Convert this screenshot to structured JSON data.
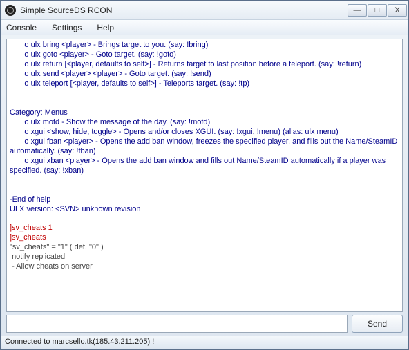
{
  "window": {
    "title": "Simple SourceDS RCON",
    "buttons": {
      "min": "—",
      "max": "□",
      "close": "X"
    }
  },
  "menu": {
    "console": "Console",
    "settings": "Settings",
    "help": "Help"
  },
  "console": {
    "blue1": "       o ulx bring <player> - Brings target to you. (say: !bring)\n       o ulx goto <player> - Goto target. (say: !goto)\n       o ulx return [<player, defaults to self>] - Returns target to last position before a teleport. (say: !return)\n       o ulx send <player> <player> - Goto target. (say: !send)\n       o ulx teleport [<player, defaults to self>] - Teleports target. (say: !tp)\n\n\nCategory: Menus\n       o ulx motd - Show the message of the day. (say: !motd)\n       o xgui <show, hide, toggle> - Opens and/or closes XGUI. (say: !xgui, !menu) (alias: ulx menu)\n       o xgui fban <player> - Opens the add ban window, freezes the specified player, and fills out the Name/SteamID automatically. (say: !fban)\n       o xgui xban <player> - Opens the add ban window and fills out Name/SteamID automatically if a player was specified. (say: !xban)\n\n\n-End of help\nULX version: <SVN> unknown revision\n",
    "red1": "]sv_cheats 1\n]sv_cheats",
    "gray1": "\"sv_cheats\" = \"1\" ( def. \"0\" )\n notify replicated\n - Allow cheats on server"
  },
  "input": {
    "value": "",
    "placeholder": ""
  },
  "send_label": "Send",
  "status": "Connected to marcsello.tk(185.43.211.205) !"
}
